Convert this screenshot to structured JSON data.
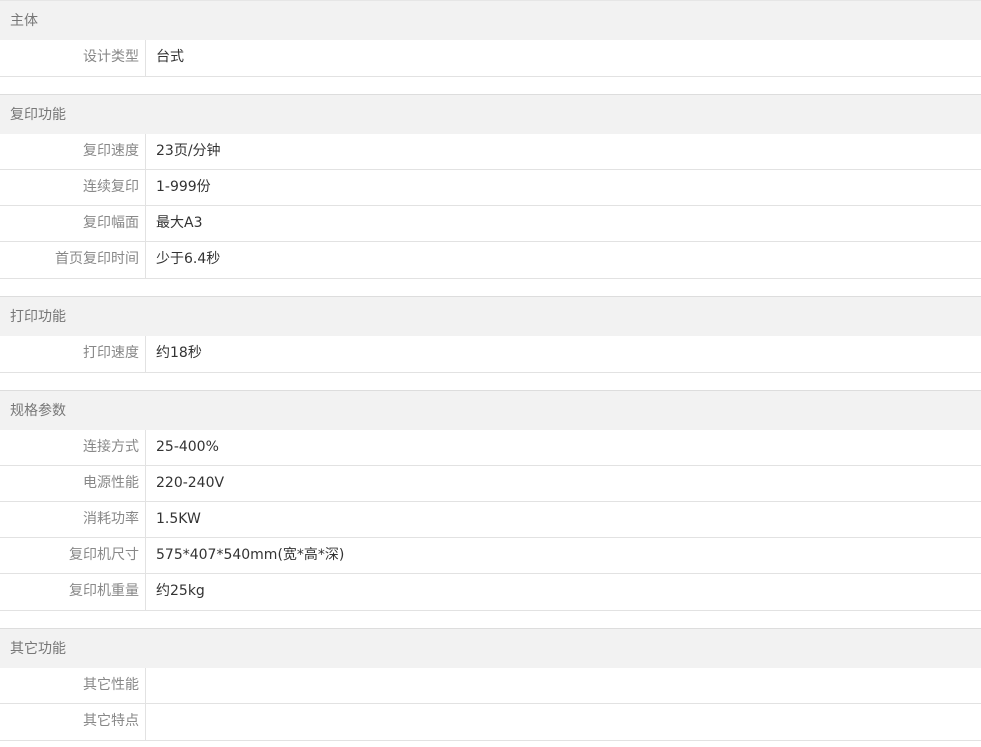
{
  "sections": [
    {
      "title": "主体",
      "rows": [
        {
          "label": "设计类型",
          "value": "台式"
        }
      ]
    },
    {
      "title": "复印功能",
      "rows": [
        {
          "label": "复印速度",
          "value": "23页/分钟"
        },
        {
          "label": "连续复印",
          "value": "1-999份"
        },
        {
          "label": "复印幅面",
          "value": "最大A3"
        },
        {
          "label": "首页复印时间",
          "value": "少于6.4秒"
        }
      ]
    },
    {
      "title": "打印功能",
      "rows": [
        {
          "label": "打印速度",
          "value": "约18秒"
        }
      ]
    },
    {
      "title": "规格参数",
      "rows": [
        {
          "label": "连接方式",
          "value": "25-400%"
        },
        {
          "label": "电源性能",
          "value": "220-240V"
        },
        {
          "label": "消耗功率",
          "value": "1.5KW"
        },
        {
          "label": "复印机尺寸",
          "value": "575*407*540mm(宽*高*深)"
        },
        {
          "label": "复印机重量",
          "value": "约25kg"
        }
      ]
    },
    {
      "title": "其它功能",
      "rows": [
        {
          "label": "其它性能",
          "value": ""
        },
        {
          "label": "其它特点",
          "value": ""
        }
      ]
    }
  ]
}
